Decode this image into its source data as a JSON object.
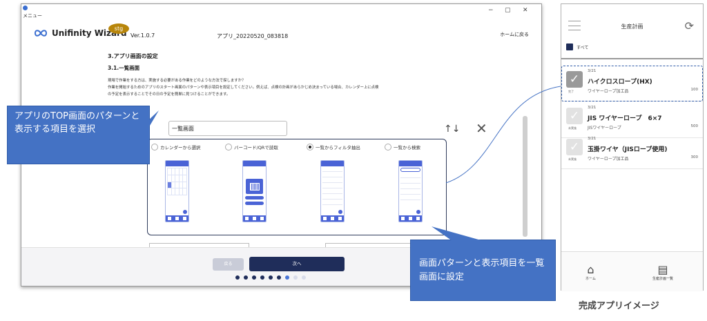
{
  "window": {
    "menu": "メニュー",
    "min": "−",
    "max": "▢",
    "close": "✕"
  },
  "header": {
    "logo": "Unifinity Wizard",
    "env": "stg",
    "version": "Ver.1.0.7",
    "app_name": "アプリ_20220520_083818",
    "home": "ホームに戻る"
  },
  "content": {
    "h1": "3.アプリ画面の設定",
    "h2": "3.1.一覧画面",
    "desc": [
      "現場で作業をする方は、実施する必要がある作業をどのような方法で探しますか？",
      "作業を開始するためのアプリのスタート画面のパターンや表示項目を設定してください。例えば、点検の計画があらかじめ決まっている場合、カレンダー上に点検",
      "の予定を表示することでその日の予定を簡単に見つけることができます。"
    ],
    "select": "一覧画面",
    "arrows": "↑↓",
    "close": "✕",
    "options": [
      {
        "label": "カレンダーから選択",
        "selected": false
      },
      {
        "label": "バーコード/QRで読取",
        "selected": false
      },
      {
        "label": "一覧からフィルタ抽出",
        "selected": true
      },
      {
        "label": "一覧から検索",
        "selected": false
      }
    ]
  },
  "footer": {
    "back": "戻る",
    "next": "次へ"
  },
  "callouts": {
    "top": "アプリのTOP画面のパターンと表示する項目を選択",
    "bottom": "画面パターンと表示項目を一覧画面に設定"
  },
  "mobile": {
    "title": "生産計画",
    "filter": "すべて",
    "items": [
      {
        "date": "3/21",
        "name": "ハイクロスロープ(HX)",
        "sub": "ワイヤーロープ加工品",
        "qty": "100",
        "status": "完了"
      },
      {
        "date": "3/21",
        "name": "JIS ワイヤーロープ　6×7",
        "sub": "JISワイヤーロープ",
        "qty": "500",
        "status": "未実施"
      },
      {
        "date": "3/21",
        "name": "玉掛ワイヤ（JISロープ使用)",
        "sub": "ワイヤーロープ加工品",
        "qty": "300",
        "status": "未実施"
      }
    ],
    "nav": [
      {
        "label": "ホーム",
        "icon": "home-icon"
      },
      {
        "label": "生産計画一覧",
        "icon": "list-icon"
      }
    ]
  },
  "caption": "完成アプリイメージ",
  "colors": {
    "accent": "#4472c4",
    "navy": "#1f2d5a",
    "phone_blue": "#4a63d6"
  }
}
